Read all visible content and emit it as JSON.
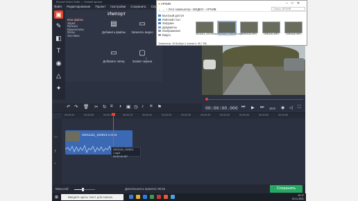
{
  "app": {
    "title": "Movavi Video Suite — Новый проект",
    "menu": [
      "Файл",
      "Редактирование",
      "Проект",
      "Настройки",
      "Сохранить",
      "Справка"
    ],
    "tools": [
      "import-icon",
      "filters-icon",
      "transitions-icon",
      "titles-icon",
      "stickers-icon",
      "callouts-icon",
      "effects-icon"
    ]
  },
  "import": {
    "title": "Импорт",
    "categories": [
      "Мои файлы",
      "Звуки",
      "Музыка",
      "Видеоклипы",
      "Фоны",
      "Заставки"
    ],
    "buttons": {
      "add_files": "Добавить файлы",
      "record_video": "Записать видео",
      "add_folder": "Добавить папку",
      "capture_screen": "Захват экрана"
    }
  },
  "player": {
    "timecode": "00:00:00.000",
    "ratio": "16:9"
  },
  "timeline": {
    "ruler": [
      "00:00:00",
      "00:00:05",
      "00:00:10",
      "00:00:15",
      "00:00:20",
      "00:00:25",
      "00:00:30",
      "00:00:35",
      "00:00:40",
      "00:00:45",
      "00:00:50",
      "00:00:55",
      "00:01:00"
    ],
    "clip_title": "20211111_102813-1.mp4",
    "tooltip_name": "20211111_102813-1.mp4",
    "tooltip_duration": "00:00:16.457"
  },
  "bottom": {
    "scale_label": "Масштаб:",
    "duration_label": "Длительность проекта:",
    "duration_value": "00:16",
    "save_label": "Сохранить"
  },
  "explorer": {
    "title": "АРХИВ",
    "address": "Этот компьютер › ВИДЕО › АРХИВ",
    "search_placeholder": "Поиск: АРХИВ",
    "nav": [
      "Быстрый доступ",
      "Рабочий стол",
      "Загрузки",
      "Документы",
      "Изображения",
      "Видео"
    ],
    "files": [
      "20211111_101700.mp4",
      "20211111_102813-1.mp4",
      "DHE4152.MP4",
      "DHE4141.MP4",
      "DHE4140.MP4",
      "DHE4139.MP4"
    ],
    "status": "Элементов: 18     Выбран 1 элемент: 56,7 МБ"
  },
  "taskbar": {
    "search_placeholder": "Введите здесь текст для поиска",
    "time": "10:17",
    "date": "20.11.2021"
  }
}
